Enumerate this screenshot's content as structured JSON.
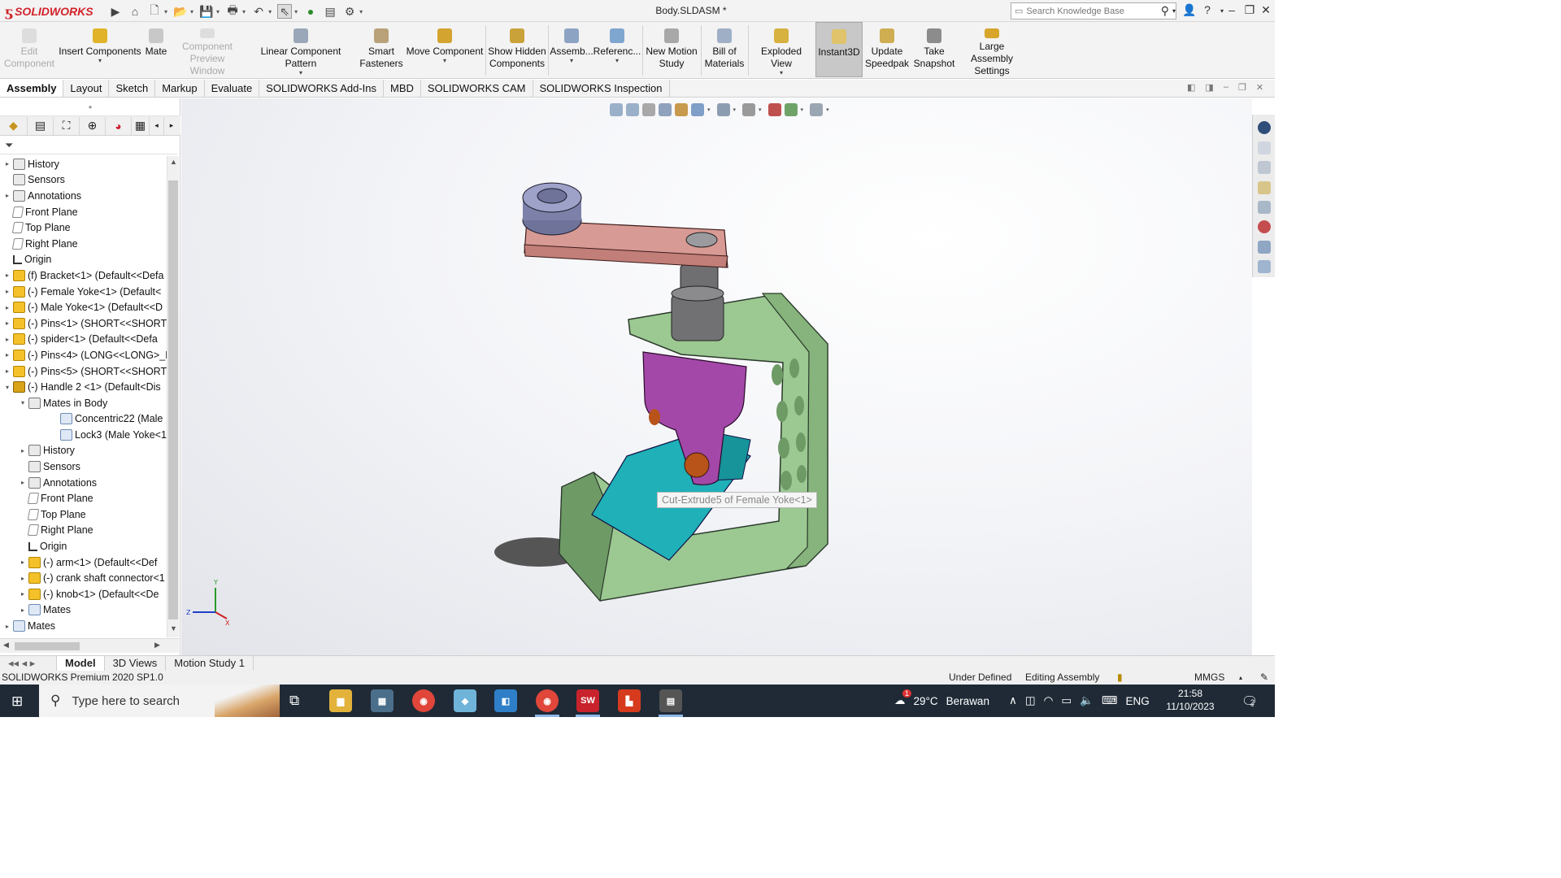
{
  "titlebar": {
    "app_name": "SOLIDWORKS",
    "document_title": "Body.SLDASM *",
    "search_placeholder": "Search Knowledge Base",
    "help_label": "?"
  },
  "commands": {
    "edit_component": [
      "Edit",
      "Component"
    ],
    "insert_components": "Insert Components",
    "mate": "Mate",
    "component_preview": [
      "Component",
      "Preview Window"
    ],
    "linear_pattern": "Linear Component Pattern",
    "smart_fasteners": [
      "Smart",
      "Fasteners"
    ],
    "move_component": "Move Component",
    "show_hidden": [
      "Show Hidden",
      "Components"
    ],
    "assembly_features": "Assemb...",
    "reference_geometry": "Referenc...",
    "new_motion_study": [
      "New Motion",
      "Study"
    ],
    "bill_of_materials": [
      "Bill of",
      "Materials"
    ],
    "exploded_view": "Exploded View",
    "instant3d": "Instant3D",
    "update_speedpak": [
      "Update",
      "Speedpak"
    ],
    "take_snapshot": [
      "Take",
      "Snapshot"
    ],
    "large_assembly": [
      "Large Assembly",
      "Settings"
    ]
  },
  "tabs": [
    "Assembly",
    "Layout",
    "Sketch",
    "Markup",
    "Evaluate",
    "SOLIDWORKS Add-Ins",
    "MBD",
    "SOLIDWORKS CAM",
    "SOLIDWORKS Inspection"
  ],
  "tree": [
    {
      "label": "History",
      "indent": 0,
      "exp": "▸",
      "icon": "history-icon"
    },
    {
      "label": "Sensors",
      "indent": 0,
      "exp": "",
      "icon": "sensors-icon"
    },
    {
      "label": "Annotations",
      "indent": 0,
      "exp": "▸",
      "icon": "annotations-icon"
    },
    {
      "label": "Front Plane",
      "indent": 0,
      "exp": "",
      "icon": "plane-icon"
    },
    {
      "label": "Top Plane",
      "indent": 0,
      "exp": "",
      "icon": "plane-icon"
    },
    {
      "label": "Right Plane",
      "indent": 0,
      "exp": "",
      "icon": "plane-icon"
    },
    {
      "label": "Origin",
      "indent": 0,
      "exp": "",
      "icon": "origin-icon"
    },
    {
      "label": "(f) Bracket<1> (Default<<Defa",
      "indent": 0,
      "exp": "▸",
      "icon": "part-icon"
    },
    {
      "label": "(-) Female Yoke<1> (Default<",
      "indent": 0,
      "exp": "▸",
      "icon": "part-icon"
    },
    {
      "label": "(-) Male Yoke<1> (Default<<D",
      "indent": 0,
      "exp": "▸",
      "icon": "part-icon"
    },
    {
      "label": "(-) Pins<1> (SHORT<<SHORT>",
      "indent": 0,
      "exp": "▸",
      "icon": "part-icon"
    },
    {
      "label": "(-) spider<1> (Default<<Defa",
      "indent": 0,
      "exp": "▸",
      "icon": "part-icon"
    },
    {
      "label": "(-) Pins<4> (LONG<<LONG>_I",
      "indent": 0,
      "exp": "▸",
      "icon": "part-icon"
    },
    {
      "label": "(-) Pins<5> (SHORT<<SHORT>",
      "indent": 0,
      "exp": "▸",
      "icon": "part-icon"
    },
    {
      "label": "(-) Handle 2 <1> (Default<Dis",
      "indent": 0,
      "exp": "▾",
      "icon": "subassembly-icon"
    },
    {
      "label": "Mates in Body",
      "indent": 1,
      "exp": "▾",
      "icon": "mates-folder-icon"
    },
    {
      "label": "Concentric22 (Male",
      "indent": 2,
      "exp": "",
      "icon": "concentric-mate-icon"
    },
    {
      "label": "Lock3 (Male Yoke<1",
      "indent": 2,
      "exp": "",
      "icon": "lock-mate-icon"
    },
    {
      "label": "History",
      "indent": 1,
      "exp": "▸",
      "icon": "history-icon"
    },
    {
      "label": "Sensors",
      "indent": 1,
      "exp": "",
      "icon": "sensors-icon"
    },
    {
      "label": "Annotations",
      "indent": 1,
      "exp": "▸",
      "icon": "annotations-icon"
    },
    {
      "label": "Front Plane",
      "indent": 1,
      "exp": "",
      "icon": "plane-icon"
    },
    {
      "label": "Top Plane",
      "indent": 1,
      "exp": "",
      "icon": "plane-icon"
    },
    {
      "label": "Right Plane",
      "indent": 1,
      "exp": "",
      "icon": "plane-icon"
    },
    {
      "label": "Origin",
      "indent": 1,
      "exp": "",
      "icon": "origin-icon"
    },
    {
      "label": "(-) arm<1> (Default<<Def",
      "indent": 1,
      "exp": "▸",
      "icon": "part-icon"
    },
    {
      "label": "(-) crank shaft connector<1",
      "indent": 1,
      "exp": "▸",
      "icon": "part-icon"
    },
    {
      "label": "(-) knob<1> (Default<<De",
      "indent": 1,
      "exp": "▸",
      "icon": "part-icon"
    },
    {
      "label": "Mates",
      "indent": 1,
      "exp": "▸",
      "icon": "mates-icon"
    },
    {
      "label": "Mates",
      "indent": 0,
      "exp": "▸",
      "icon": "mates-icon"
    }
  ],
  "viewport": {
    "tooltip": "Cut-Extrude5 of Female Yoke<1>",
    "triad": {
      "x": "X",
      "y": "Y",
      "z": "Z"
    }
  },
  "bottom_tabs": [
    "Model",
    "3D Views",
    "Motion Study 1"
  ],
  "status": {
    "version": "SOLIDWORKS Premium 2020 SP1.0",
    "definition": "Under Defined",
    "mode": "Editing Assembly",
    "units": "MMGS"
  },
  "taskbar": {
    "search_placeholder": "Type here to search",
    "weather_temp": "29°C",
    "weather_desc": "Berawan",
    "weather_badge": "1",
    "language": "ENG",
    "time": "21:58",
    "date": "11/10/2023",
    "notification_count": "2"
  },
  "colors": {
    "bracket": "#9cc892",
    "yoke_female": "#a348a8",
    "yoke_male": "#1fb0b8",
    "arm": "#d89a94",
    "knob": "#7d80a8",
    "shaft": "#6f6f72",
    "pin": "#b8541a"
  }
}
